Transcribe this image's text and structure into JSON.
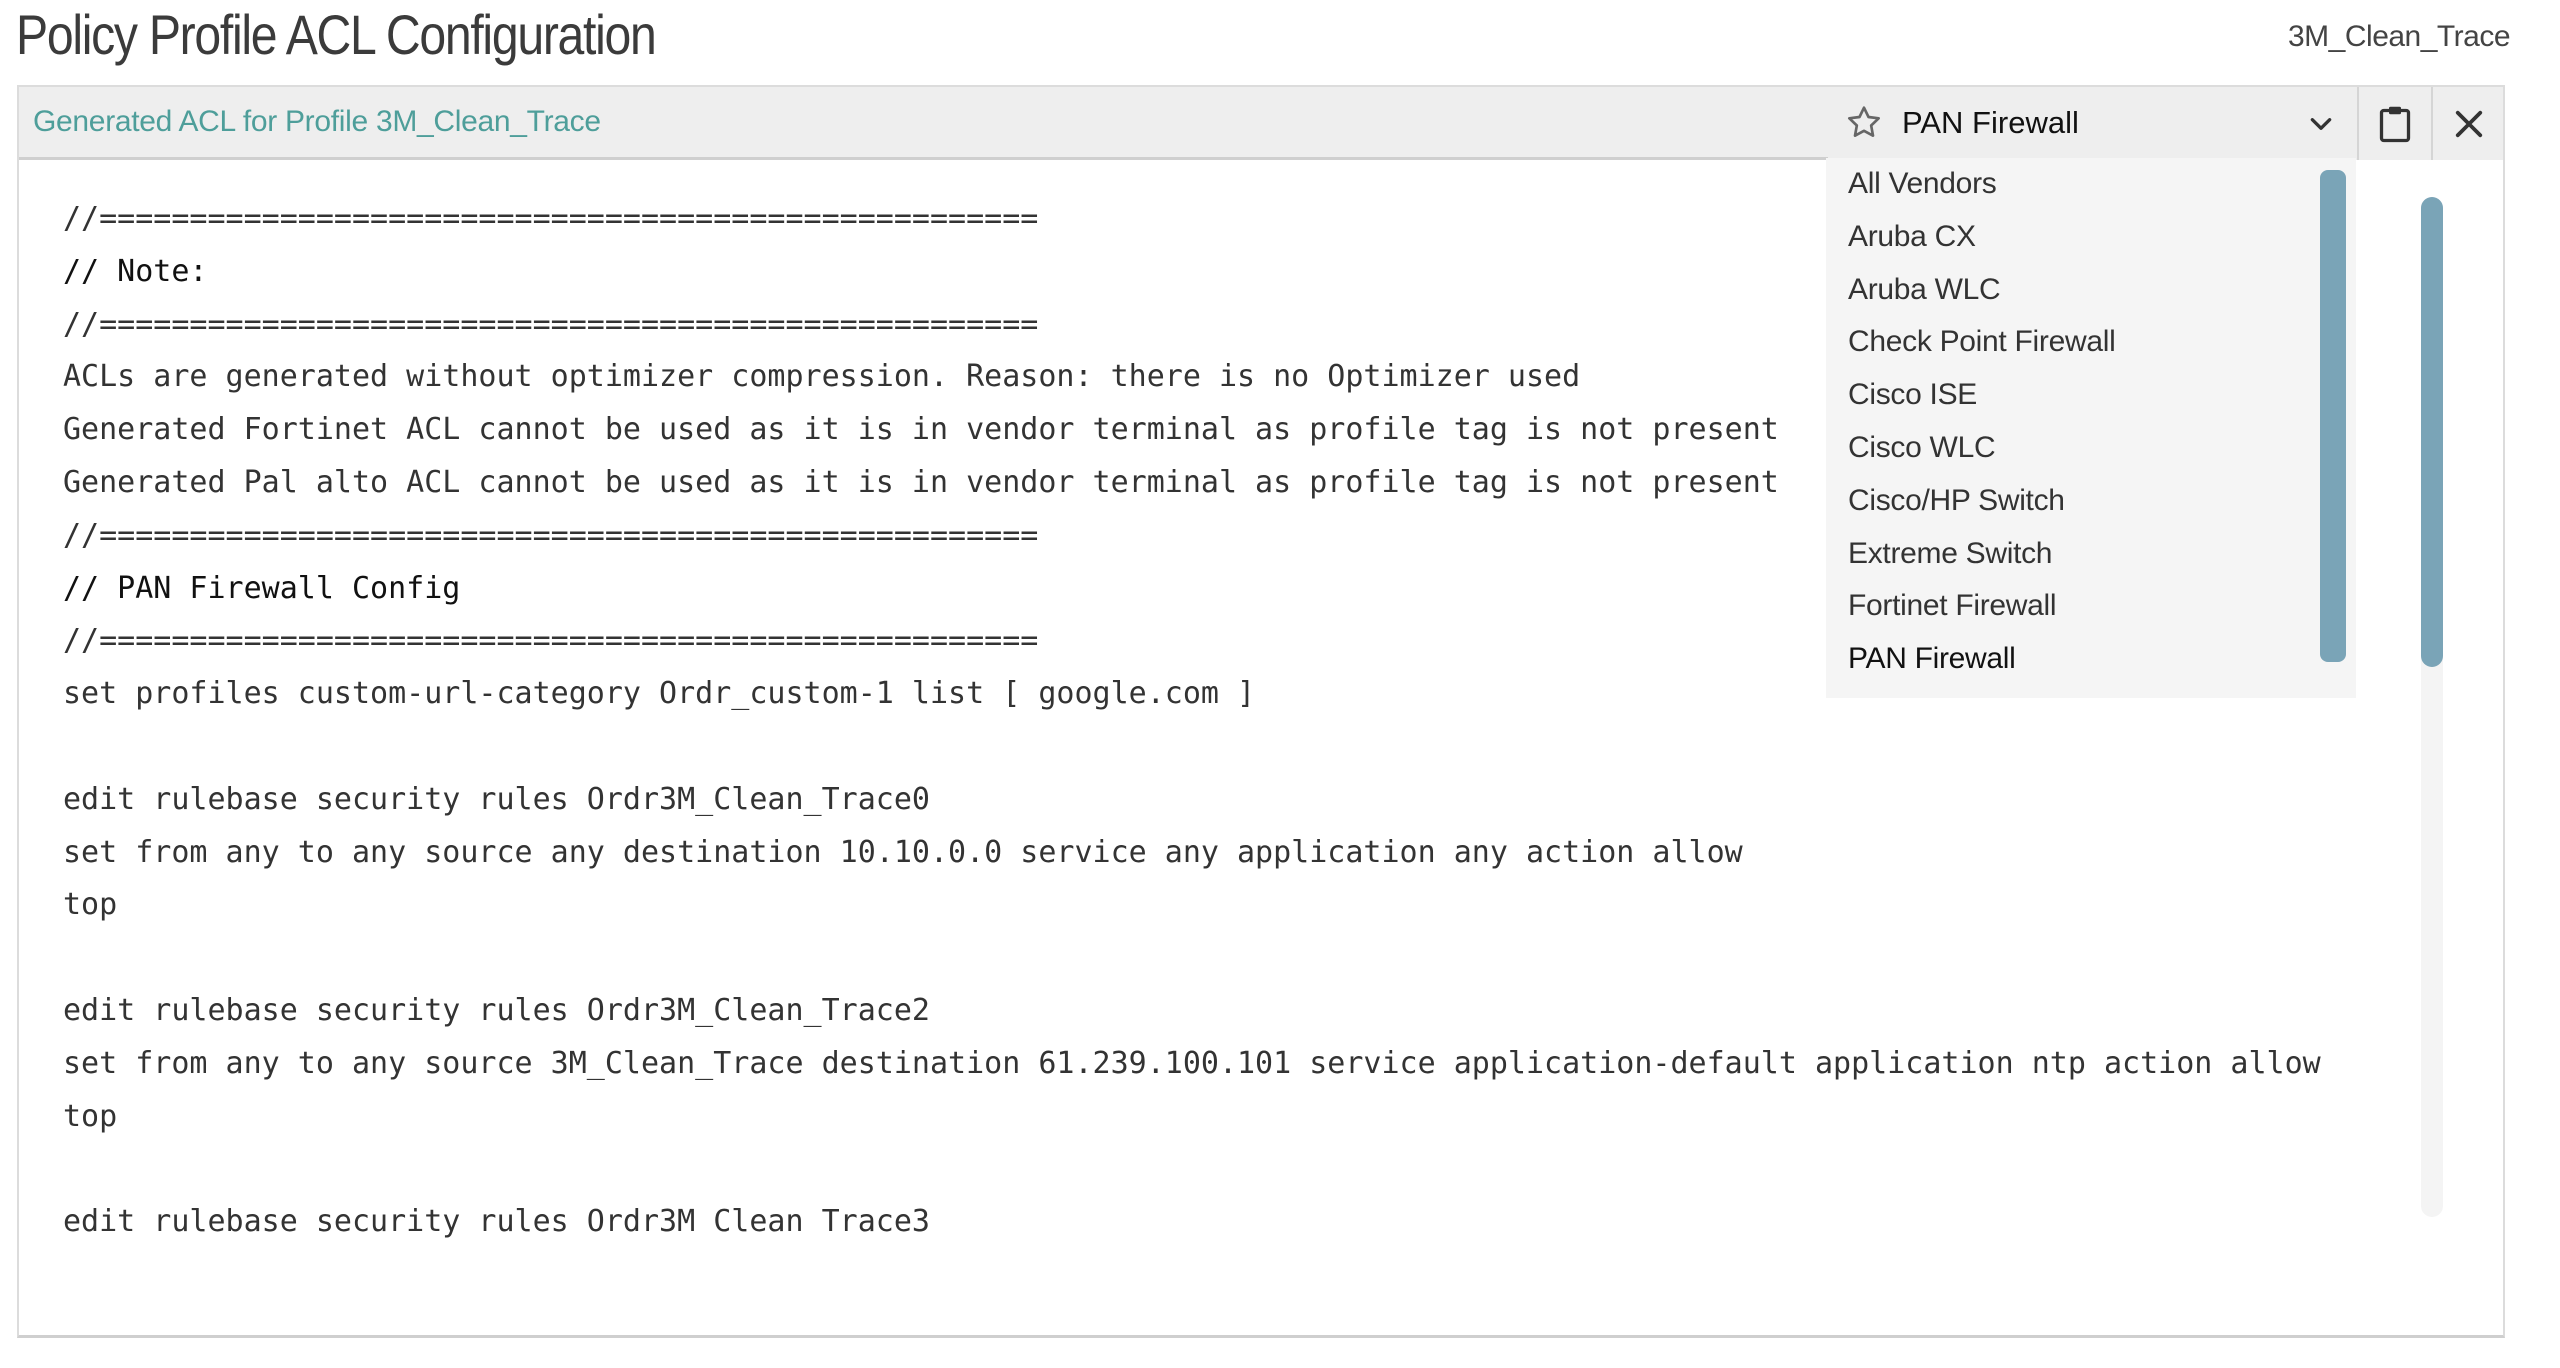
{
  "header": {
    "title": "Policy Profile ACL Configuration",
    "profile_name": "3M_Clean_Trace"
  },
  "panel": {
    "subtitle": "Generated ACL for Profile 3M_Clean_Trace"
  },
  "vendor_select": {
    "selected": "PAN Firewall",
    "options": [
      "All Vendors",
      "Aruba CX",
      "Aruba WLC",
      "Check Point Firewall",
      "Cisco ISE",
      "Cisco WLC",
      "Cisco/HP Switch",
      "Extreme Switch",
      "Fortinet Firewall",
      "PAN Firewall"
    ]
  },
  "icons": {
    "star": "star-icon",
    "chevron": "chevron-down-icon",
    "copy": "clipboard-icon",
    "close": "close-icon"
  },
  "colors": {
    "accent": "#4e9e9a",
    "scrollbar": "#7aa4b7",
    "header_bg": "#eeeeee"
  },
  "code": {
    "lines": [
      "//====================================================",
      "// Note:",
      "//====================================================",
      "ACLs are generated without optimizer compression. Reason: there is no Optimizer used",
      "Generated Fortinet ACL cannot be used as it is in vendor terminal as profile tag is not present",
      "Generated Pal alto ACL cannot be used as it is in vendor terminal as profile tag is not present",
      "//====================================================",
      "// PAN Firewall Config",
      "//====================================================",
      "set profiles custom-url-category Ordr_custom-1 list [ google.com ]",
      "",
      "edit rulebase security rules Ordr3M_Clean_Trace0",
      "set from any to any source any destination 10.10.0.0 service any application any action allow",
      "top",
      "",
      "edit rulebase security rules Ordr3M_Clean_Trace2",
      "set from any to any source 3M_Clean_Trace destination 61.239.100.101 service application-default application ntp action allow",
      "top",
      "",
      "edit rulebase security rules Ordr3M Clean Trace3"
    ]
  }
}
